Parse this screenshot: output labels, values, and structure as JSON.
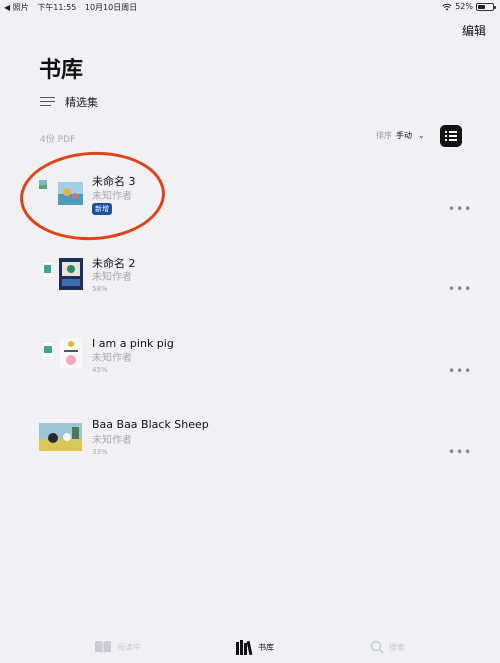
{
  "status_bar": {
    "back_app": "◀ 照片",
    "time": "下午11:55",
    "date": "10月10日周日",
    "battery": "52%",
    "battery_level": 0.52
  },
  "header": {
    "edit": "编辑",
    "title": "书库",
    "collections": "精选集"
  },
  "toolbar": {
    "count": "4份 PDF",
    "sort_label": "排序",
    "sort_value": "手动"
  },
  "books": [
    {
      "title": "未命名 3",
      "author": "未知作者",
      "badge": "新增",
      "progress": ""
    },
    {
      "title": "未命名 2",
      "author": "未知作者",
      "badge": "",
      "progress": "58%"
    },
    {
      "title": "I am a pink pig",
      "author": "未知作者",
      "badge": "",
      "progress": "45%"
    },
    {
      "title": "Baa Baa Black Sheep",
      "author": "未知作者",
      "badge": "",
      "progress": "33%"
    }
  ],
  "more_glyph": "•••",
  "tabbar": {
    "reading_now": "阅读中",
    "library": "书库",
    "search": "搜索"
  },
  "colors": {
    "accent": "#1d4fa0",
    "annotation": "#e0431c",
    "background": "#f1f1f3"
  }
}
